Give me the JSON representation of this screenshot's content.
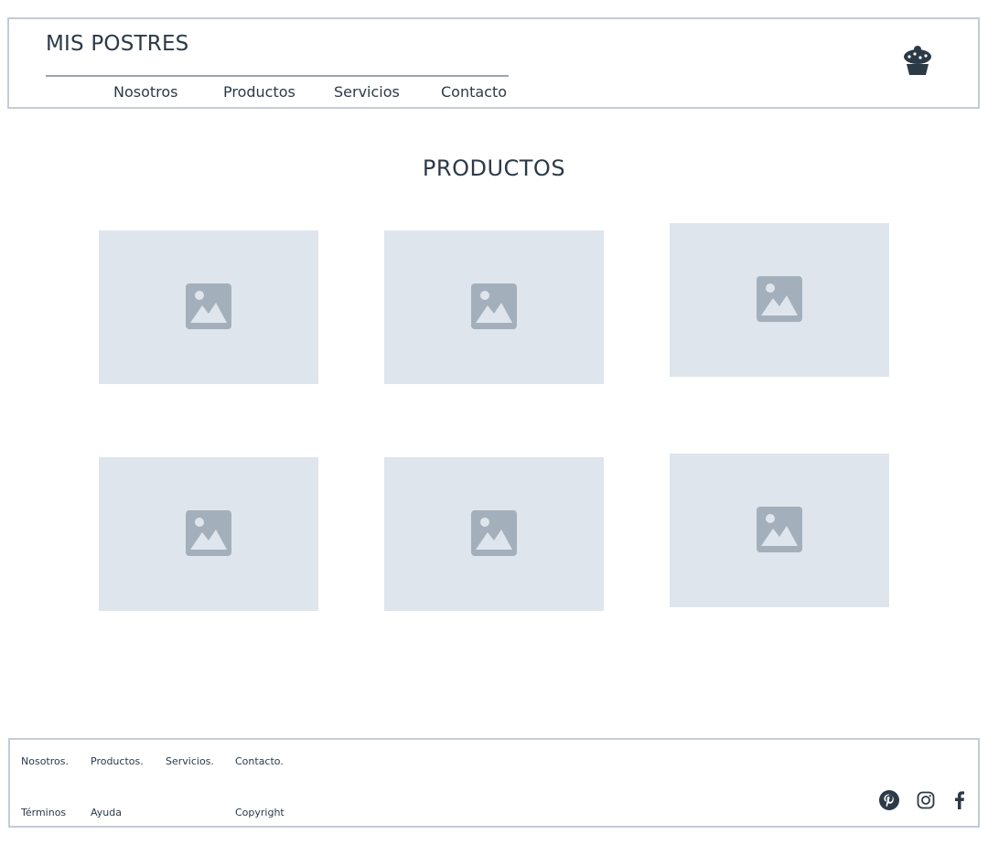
{
  "header": {
    "brand": "MIS POSTRES",
    "nav": [
      "Nosotros",
      "Productos",
      "Servicios",
      "Contacto"
    ],
    "logo_icon": "cupcake-icon"
  },
  "main": {
    "title": "PRODUCTOS",
    "product_icon": "image-placeholder-icon"
  },
  "footer": {
    "links_row1": [
      "Nosotros.",
      "Productos.",
      "Servicios.",
      "Contacto."
    ],
    "links_row2": [
      "Términos",
      "Ayuda",
      "Copyright"
    ],
    "social": [
      "pinterest-icon",
      "instagram-icon",
      "facebook-icon"
    ]
  },
  "colors": {
    "text": "#2c3a47",
    "border": "#c4ccd5",
    "placeholder_bg": "#dfe5ec",
    "placeholder_icon": "#a3b0bb"
  }
}
